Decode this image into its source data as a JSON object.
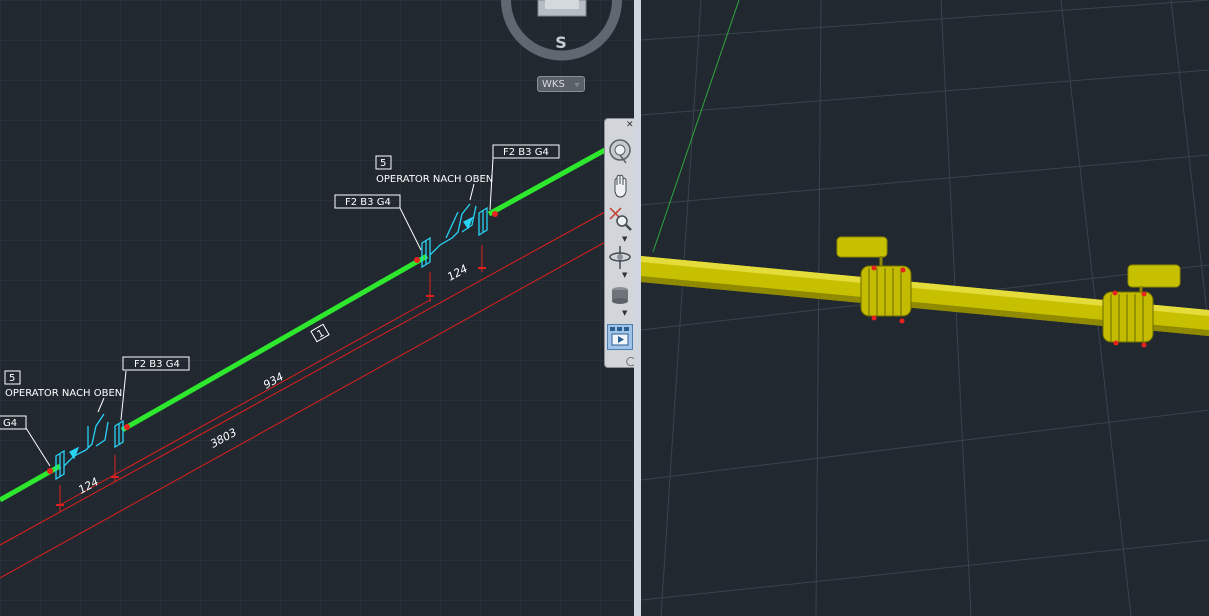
{
  "left_view": {
    "viewcube": {
      "compass_label": "S",
      "wcs_label": "WKS"
    },
    "annotations": {
      "item_number": "5",
      "operator_note": "OPERATOR NACH OBEN",
      "tag": "F2  B3  G4",
      "tag_partial": "G4",
      "segment_number": "1",
      "dim_short": "124",
      "dim_mid": "934",
      "dim_long": "3803"
    },
    "navigation_bar": {
      "tools": [
        "steering-wheel-icon",
        "pan-icon",
        "zoom-extents-icon",
        "orbit-icon",
        "showmotion-icon",
        "viewport-tiles-icon"
      ]
    }
  },
  "colors": {
    "background": "#212830",
    "pipe_2d": "#2ee82e",
    "symbol": "#29d3f5",
    "dimension": "#e0201c",
    "pipe_3d": "#c7c000",
    "grid": "#3a4550"
  }
}
